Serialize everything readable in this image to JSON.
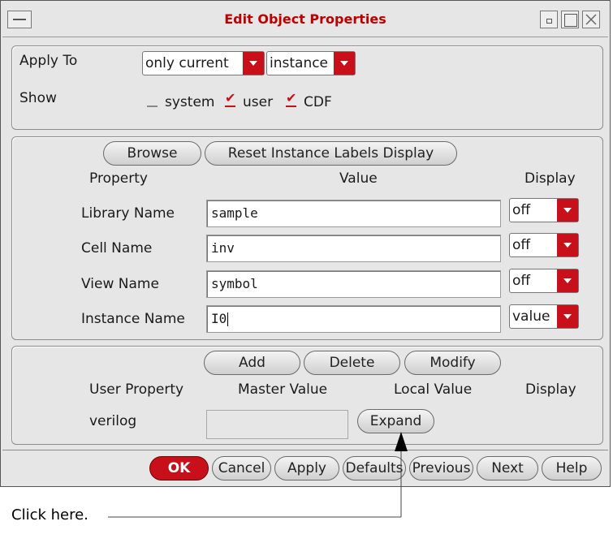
{
  "window": {
    "title": "Edit Object Properties"
  },
  "apply_to": {
    "label": "Apply To",
    "scope": {
      "value": "only current"
    },
    "type": {
      "value": "instance"
    }
  },
  "show": {
    "label": "Show",
    "options": [
      {
        "label": "system",
        "checked": false
      },
      {
        "label": "user",
        "checked": true
      },
      {
        "label": "CDF",
        "checked": true
      }
    ]
  },
  "instance_panel": {
    "browse_label": "Browse",
    "reset_label": "Reset Instance Labels Display",
    "headers": {
      "property": "Property",
      "value": "Value",
      "display": "Display"
    },
    "rows": [
      {
        "property": "Library Name",
        "value": "sample",
        "display": "off"
      },
      {
        "property": "Cell Name",
        "value": "inv",
        "display": "off"
      },
      {
        "property": "View Name",
        "value": "symbol",
        "display": "off"
      },
      {
        "property": "Instance Name",
        "value": "I0",
        "display": "value"
      }
    ]
  },
  "user_panel": {
    "add_label": "Add",
    "delete_label": "Delete",
    "modify_label": "Modify",
    "headers": {
      "user_property": "User Property",
      "master_value": "Master Value",
      "local_value": "Local Value",
      "display": "Display"
    },
    "row": {
      "property": "verilog",
      "master_value": "",
      "expand_label": "Expand"
    }
  },
  "footer": {
    "ok": "OK",
    "cancel": "Cancel",
    "apply": "Apply",
    "defaults": "Defaults",
    "previous": "Previous",
    "next": "Next",
    "help": "Help"
  },
  "callout": {
    "text": "Click here."
  }
}
